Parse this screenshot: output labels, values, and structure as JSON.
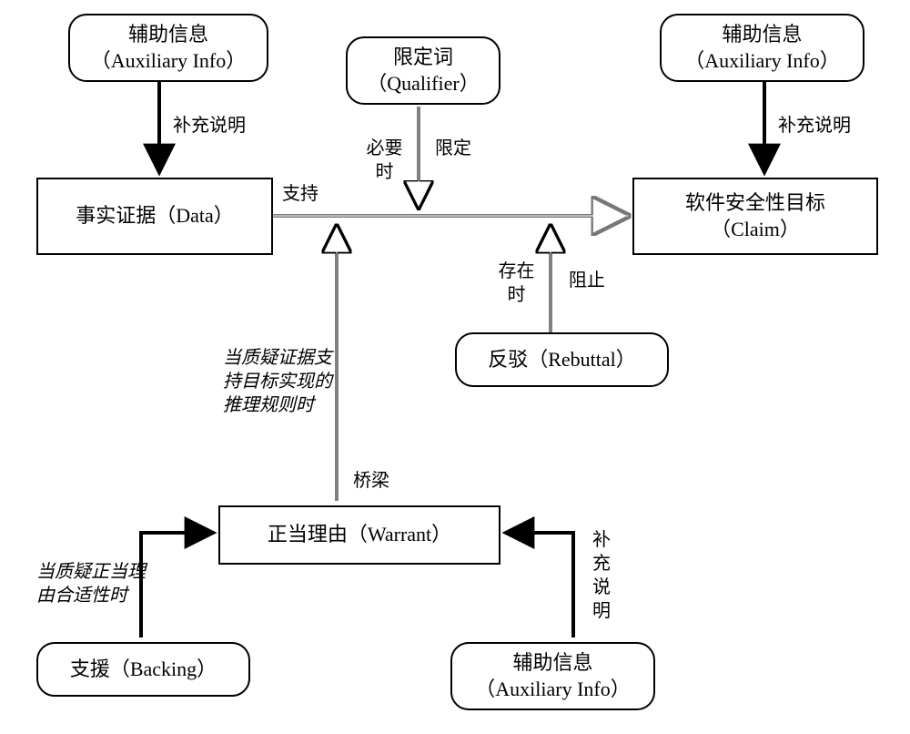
{
  "nodes": {
    "aux_left": {
      "cn": "辅助信息",
      "en": "（Auxiliary Info）"
    },
    "aux_right": {
      "cn": "辅助信息",
      "en": "（Auxiliary Info）"
    },
    "aux_bottom": {
      "cn": "辅助信息",
      "en": "（Auxiliary Info）"
    },
    "qualifier": {
      "cn": "限定词",
      "en": "（Qualifier）"
    },
    "data": {
      "text": "事实证据（Data）"
    },
    "claim": {
      "cn": "软件安全性目标",
      "en": "（Claim）"
    },
    "warrant": {
      "text": "正当理由（Warrant）"
    },
    "rebuttal": {
      "text": "反驳（Rebuttal）"
    },
    "backing": {
      "text": "支援（Backing）"
    }
  },
  "edges": {
    "aux_to_data": "补充说明",
    "aux_to_claim": "补充说明",
    "aux_to_warrant": "补充说明",
    "data_to_claim": "支持",
    "qualifier_when": "必要时",
    "qualifier_limit": "限定",
    "rebuttal_when": "存在时",
    "rebuttal_block": "阻止",
    "warrant_bridge": "桥梁",
    "warrant_note": "当质疑证据支持目标实现的推理规则时",
    "backing_note": "当质疑正当理由合适性时"
  }
}
